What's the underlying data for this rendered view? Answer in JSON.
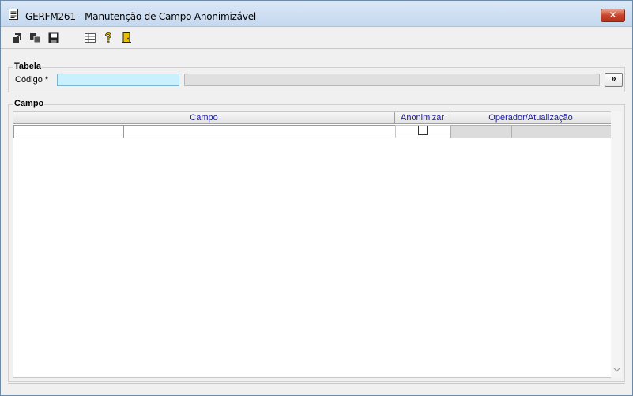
{
  "window": {
    "title": "GERFM261 - Manutenção de Campo Anonimizável",
    "close_symbol": "✕"
  },
  "toolbar": {
    "icons": [
      "import-icon",
      "copy-icon",
      "save-icon",
      "table-icon",
      "help-icon",
      "exit-icon"
    ]
  },
  "tabela": {
    "group_title": "Tabela",
    "codigo_label": "Código *",
    "codigo_value": "",
    "descricao_value": "",
    "lookup_label": "»"
  },
  "campo": {
    "group_title": "Campo",
    "columns": [
      "Campo",
      "Anonimizar",
      "Operador/Atualização"
    ]
  },
  "colors": {
    "accent_input": "#c8f0ff",
    "header_text": "#1a1aa0",
    "close_red": "#c9442c"
  }
}
